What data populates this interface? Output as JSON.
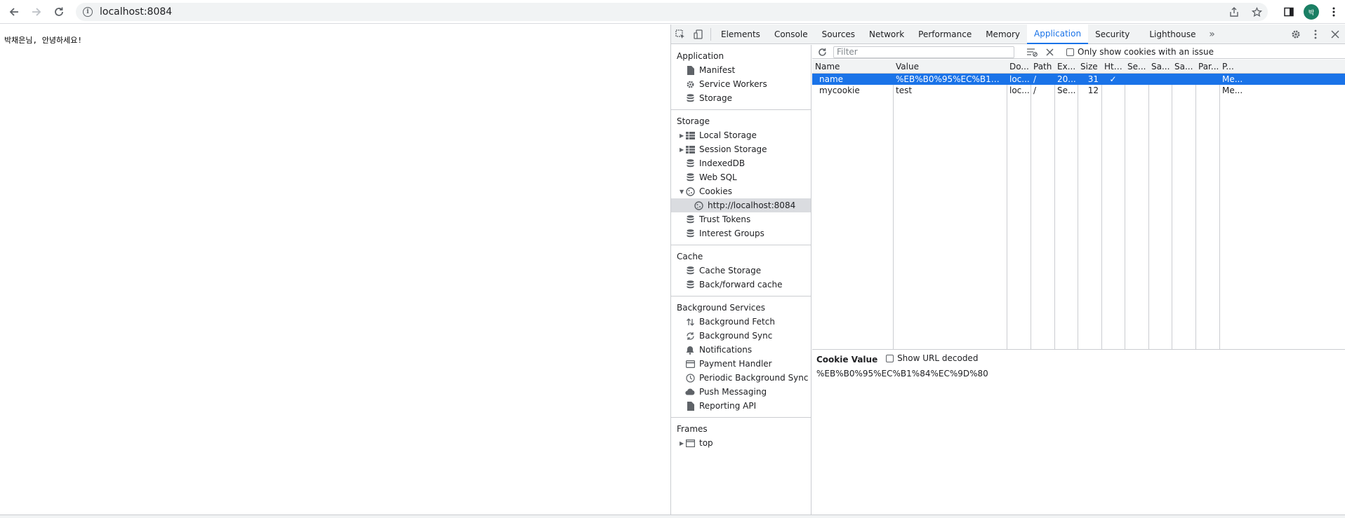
{
  "browser": {
    "url": "localhost:8084"
  },
  "page": {
    "greeting": "박채은님, 안녕하세요!"
  },
  "devtools": {
    "tabs": [
      "Elements",
      "Console",
      "Sources",
      "Network",
      "Performance",
      "Memory",
      "Application",
      "Security",
      "Lighthouse"
    ],
    "active_tab": "Application",
    "sidebar": {
      "application": {
        "title": "Application",
        "items": [
          "Manifest",
          "Service Workers",
          "Storage"
        ]
      },
      "storage": {
        "title": "Storage",
        "items": [
          "Local Storage",
          "Session Storage",
          "IndexedDB",
          "Web SQL",
          "Cookies",
          "http://localhost:8084",
          "Trust Tokens",
          "Interest Groups"
        ]
      },
      "cache": {
        "title": "Cache",
        "items": [
          "Cache Storage",
          "Back/forward cache"
        ]
      },
      "background": {
        "title": "Background Services",
        "items": [
          "Background Fetch",
          "Background Sync",
          "Notifications",
          "Payment Handler",
          "Periodic Background Sync",
          "Push Messaging",
          "Reporting API"
        ]
      },
      "frames": {
        "title": "Frames",
        "items": [
          "top"
        ]
      }
    },
    "filter": {
      "placeholder": "Filter",
      "only_issue_label": "Only show cookies with an issue"
    },
    "table": {
      "headers": [
        "Name",
        "Value",
        "Do...",
        "Path",
        "Ex...",
        "Size",
        "Htt...",
        "Se...",
        "Sa...",
        "Sa...",
        "Par...",
        "P..."
      ],
      "rows": [
        [
          "name",
          "%EB%B0%95%EC%B1%84%EC%9D%80",
          "loc...",
          "/",
          "20...",
          "31",
          "✓",
          "",
          "",
          "",
          "",
          "Me..."
        ],
        [
          "mycookie",
          "test",
          "loc...",
          "/",
          "Se...",
          "12",
          "",
          "",
          "",
          "",
          "",
          "Me..."
        ]
      ]
    },
    "cookie_value": {
      "title": "Cookie Value",
      "decode_label": "Show URL decoded",
      "value": "%EB%B0%95%EC%B1%84%EC%9D%80"
    }
  }
}
